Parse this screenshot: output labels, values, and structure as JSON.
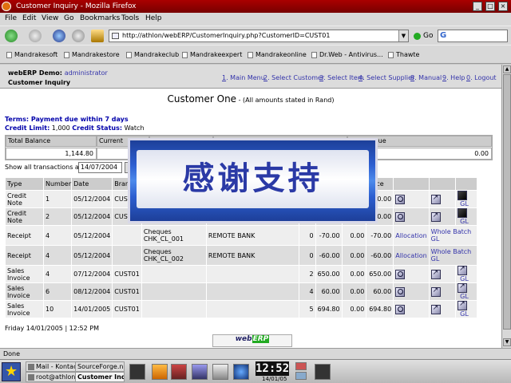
{
  "window": {
    "title": "Customer Inquiry - Mozilla Firefox",
    "btn_min": "_",
    "btn_max": "□",
    "btn_close": "×"
  },
  "menubar": [
    "File",
    "Edit",
    "View",
    "Go",
    "Bookmarks",
    "Tools",
    "Help"
  ],
  "navbar": {
    "url": "http://athlon/webERP/CustomerInquiry.php?CustomerID=CUST01",
    "url_dropdown": "▼",
    "go_label": "Go",
    "search_glyph": "G"
  },
  "bookmarks": [
    "Mandrakesoft",
    "Mandrakestore",
    "Mandrakeclub",
    "Mandrakeexpert",
    "Mandrakeonline",
    "Dr.Web - Antivirus...",
    "Thawte"
  ],
  "header": {
    "demo_label": "webERP Demo:",
    "user": "administrator",
    "page_name": "Customer Inquiry",
    "menu": [
      {
        "key": "1",
        "label": ". Main Menu"
      },
      {
        "key": "2",
        "label": ". Select Customer"
      },
      {
        "key": "3",
        "label": ". Select Item"
      },
      {
        "key": "4",
        "label": ". Select Supplier"
      },
      {
        "key": "8",
        "label": ". Manual"
      },
      {
        "key": "9",
        "label": ". Help"
      },
      {
        "key": "0",
        "label": ". Logout"
      }
    ]
  },
  "customer": {
    "name": "Customer One",
    "note": " - (All amounts stated in Rand)",
    "terms": "Terms: Payment due within 7 days",
    "credit_limit_label": "Credit Limit:",
    "credit_limit": " 1,000 ",
    "credit_status_label": "Credit Status:",
    "credit_status": " Watch"
  },
  "balance": {
    "headers": [
      "Total Balance",
      "Current",
      "",
      "",
      "ys Overdue"
    ],
    "values": [
      "1,144.80",
      "",
      "",
      "",
      "0.00"
    ]
  },
  "filter": {
    "label": "Show all transactions after:",
    "date": "14/07/2004"
  },
  "table": {
    "headers": [
      "Type",
      "Number",
      "Date",
      "Branch",
      "",
      "",
      "",
      "",
      "",
      "ance",
      "",
      "",
      ""
    ],
    "rows": [
      {
        "type": "Credit Note",
        "number": "1",
        "date": "05/12/2004",
        "branch": "CUST01",
        "ref": "",
        "comment": "",
        "order": "",
        "total": "",
        "alloc": "",
        "balance": "-70.00",
        "col10": "",
        "col11": "",
        "col12": "GL",
        "kind": "credit"
      },
      {
        "type": "Credit Note",
        "number": "2",
        "date": "05/12/2004",
        "branch": "CUST01",
        "ref": "",
        "comment": "",
        "order": "",
        "total": "",
        "alloc": "",
        "balance": "-70.00",
        "col10": "",
        "col11": "",
        "col12": "GL",
        "kind": "credit"
      },
      {
        "type": "Receipt",
        "number": "4",
        "date": "05/12/2004",
        "branch": "",
        "ref": "Cheques CHK_CL_001",
        "comment": "REMOTE BANK",
        "order": "0",
        "total": "-70.00",
        "alloc": "0.00",
        "balance": "-70.00",
        "col10": "Allocation",
        "col11": "Whole Batch GL",
        "col12": "",
        "kind": "receipt"
      },
      {
        "type": "Receipt",
        "number": "4",
        "date": "05/12/2004",
        "branch": "",
        "ref": "Cheques CHK_CL_002",
        "comment": "REMOTE BANK",
        "order": "0",
        "total": "-60.00",
        "alloc": "0.00",
        "balance": "-60.00",
        "col10": "Allocation",
        "col11": "Whole Batch GL",
        "col12": "",
        "kind": "receipt"
      },
      {
        "type": "Sales Invoice",
        "number": "4",
        "date": "07/12/2004",
        "branch": "CUST01",
        "ref": "",
        "comment": "",
        "order": "2",
        "total": "650.00",
        "alloc": "0.00",
        "balance": "650.00",
        "col10": "",
        "col11": "",
        "col12": "GL",
        "kind": "invoice"
      },
      {
        "type": "Sales Invoice",
        "number": "6",
        "date": "08/12/2004",
        "branch": "CUST01",
        "ref": "",
        "comment": "",
        "order": "4",
        "total": "60.00",
        "alloc": "0.00",
        "balance": "60.00",
        "col10": "",
        "col11": "",
        "col12": "GL",
        "kind": "invoice"
      },
      {
        "type": "Sales Invoice",
        "number": "10",
        "date": "14/01/2005",
        "branch": "CUST01",
        "ref": "",
        "comment": "",
        "order": "5",
        "total": "694.80",
        "alloc": "0.00",
        "balance": "694.80",
        "col10": "",
        "col11": "",
        "col12": "GL",
        "kind": "invoice"
      }
    ]
  },
  "page_footer": {
    "datetime": "Friday 14/01/2005 | 12:52 PM",
    "logo_web": "web",
    "logo_erp": "ERP"
  },
  "overlay": {
    "text": "感谢支持"
  },
  "status": "Done",
  "taskbar": {
    "tasks": [
      "Mail - Kontact",
      "SourceForge.n",
      "root@athlon: /u",
      "Customer Inq"
    ],
    "clock": "12:52",
    "clock_date": "14/01/05"
  }
}
